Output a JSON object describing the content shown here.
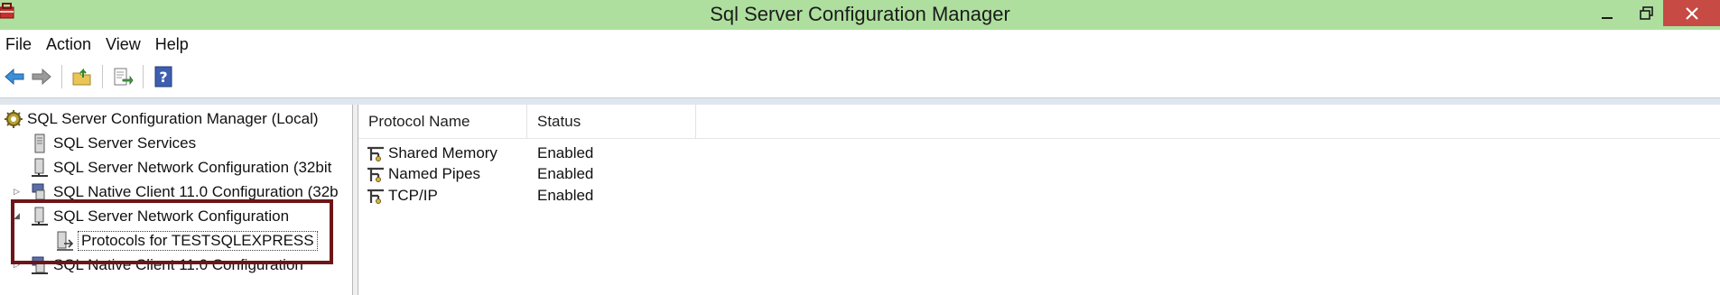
{
  "window": {
    "title": "Sql Server Configuration Manager"
  },
  "menu": [
    "File",
    "Action",
    "View",
    "Help"
  ],
  "toolbar": {
    "buttons": [
      "back-icon",
      "forward-icon",
      "up-folder-icon",
      "export-list-icon",
      "help-icon"
    ]
  },
  "tree": {
    "root": "SQL Server Configuration Manager (Local)",
    "items": [
      "SQL Server Services",
      "SQL Server Network Configuration (32bit",
      "SQL Native Client 11.0 Configuration (32b",
      "SQL Server Network Configuration",
      "Protocols for TESTSQLEXPRESS",
      "SQL Native Client 11.0 Configuration"
    ]
  },
  "list": {
    "columns": [
      "Protocol Name",
      "Status"
    ],
    "rows": [
      {
        "name": "Shared Memory",
        "status": "Enabled"
      },
      {
        "name": "Named Pipes",
        "status": "Enabled"
      },
      {
        "name": "TCP/IP",
        "status": "Enabled"
      }
    ]
  },
  "colors": {
    "titlebar": "#aedf9e",
    "close_button": "#c74a44",
    "highlight_box": "#6e1518"
  }
}
